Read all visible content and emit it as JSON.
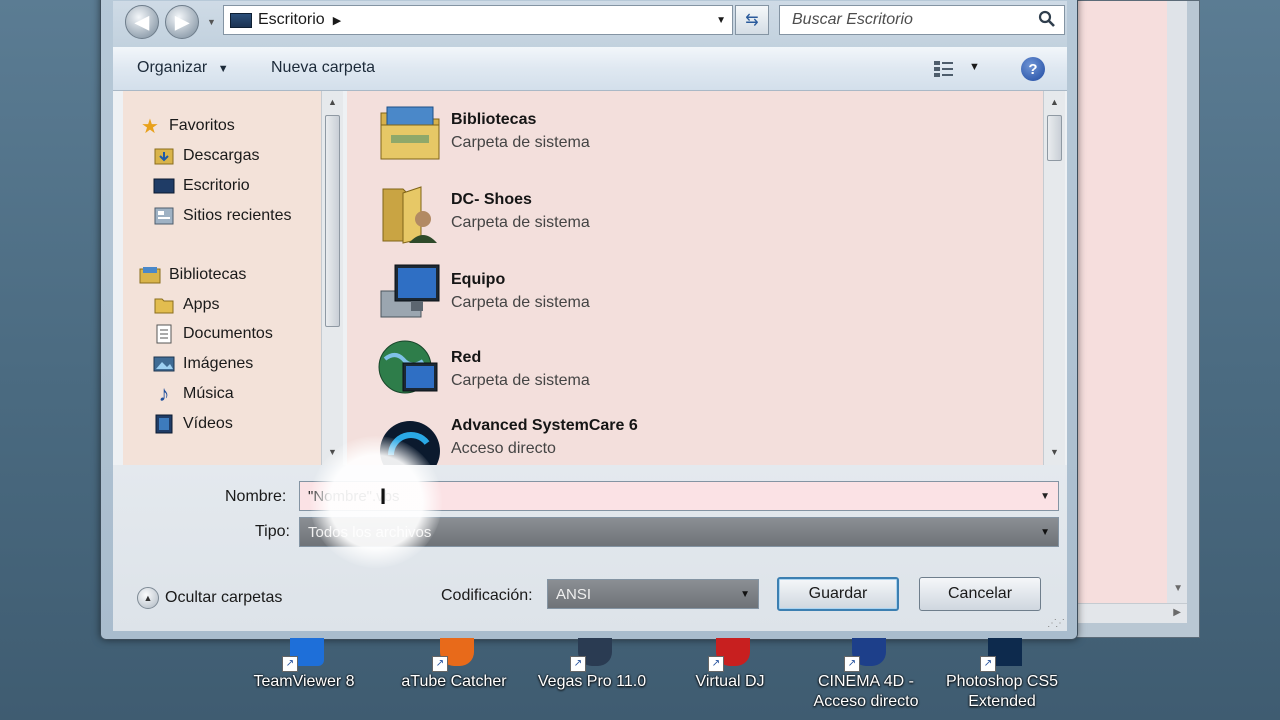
{
  "address_bar": {
    "location": "Escritorio",
    "search_placeholder": "Buscar Escritorio"
  },
  "toolbar": {
    "organize_label": "Organizar",
    "new_folder_label": "Nueva carpeta"
  },
  "nav_pane": {
    "favorites_label": "Favoritos",
    "favorites": [
      "Descargas",
      "Escritorio",
      "Sitios recientes"
    ],
    "libraries_label": "Bibliotecas",
    "libraries": [
      "Apps",
      "Documentos",
      "Imágenes",
      "Música",
      "Vídeos"
    ]
  },
  "files": [
    {
      "name": "Bibliotecas",
      "type": "Carpeta de sistema",
      "icon": "libraries-folder-icon"
    },
    {
      "name": "DC- Shoes",
      "type": "Carpeta de sistema",
      "icon": "user-folder-icon"
    },
    {
      "name": "Equipo",
      "type": "Carpeta de sistema",
      "icon": "computer-icon"
    },
    {
      "name": "Red",
      "type": "Carpeta de sistema",
      "icon": "network-icon"
    },
    {
      "name": "Advanced SystemCare 6",
      "type": "Acceso directo",
      "icon": "advanced-systemcare-icon"
    }
  ],
  "form": {
    "filename_label": "Nombre:",
    "filename_value": "\"Nombre\".vbs",
    "filetype_label": "Tipo:",
    "filetype_value": "Todos los archivos",
    "encoding_label": "Codificación:",
    "encoding_value": "ANSI",
    "save_label": "Guardar",
    "cancel_label": "Cancelar",
    "hide_folders_label": "Ocultar carpetas"
  },
  "desktop_icons": [
    {
      "label": "TeamViewer 8",
      "color": "#1e6fd9"
    },
    {
      "label": "aTube Catcher",
      "color": "#e86a1a"
    },
    {
      "label": "Vegas Pro 11.0",
      "color": "#2a3b52"
    },
    {
      "label": "Virtual DJ",
      "color": "#c81f1f"
    },
    {
      "label": "CINEMA 4D - Acceso directo",
      "color": "#1d3f8a"
    },
    {
      "label": "Photoshop CS5 Extended",
      "color": "#0d2a4d"
    }
  ]
}
